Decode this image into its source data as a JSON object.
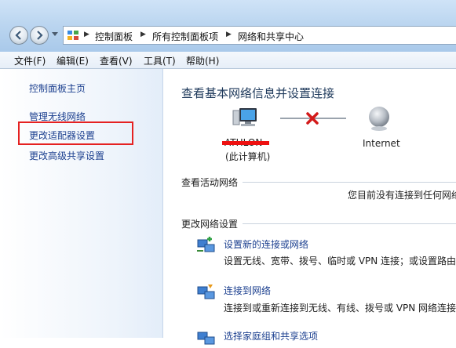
{
  "breadcrumb": {
    "items": [
      "控制面板",
      "所有控制面板项",
      "网络和共享中心"
    ]
  },
  "menu": {
    "items": [
      "文件(F)",
      "编辑(E)",
      "查看(V)",
      "工具(T)",
      "帮助(H)"
    ]
  },
  "sidebar": {
    "items": [
      {
        "label": "控制面板主页"
      },
      {
        "label": "管理无线网络"
      },
      {
        "label": "更改适配器设置",
        "highlighted": true
      },
      {
        "label": "更改高级共享设置"
      }
    ]
  },
  "main": {
    "title": "查看基本网络信息并设置连接",
    "network_map": {
      "computer_name": "ATHLON",
      "computer_sub": "(此计算机)",
      "internet_label": "Internet",
      "connection_status": "disconnected"
    },
    "active_networks": {
      "label": "查看活动网络",
      "status": "您目前没有连接到任何网络"
    },
    "change_settings": {
      "label": "更改网络设置",
      "tasks": [
        {
          "link": "设置新的连接或网络",
          "desc": "设置无线、宽带、拨号、临时或 VPN 连接；或设置路由"
        },
        {
          "link": "连接到网络",
          "desc": "连接到或重新连接到无线、有线、拨号或 VPN 网络连接"
        },
        {
          "link": "选择家庭组和共享选项",
          "desc": ""
        }
      ]
    }
  },
  "colors": {
    "link": "#1b3f8f",
    "title": "#1e395b",
    "highlight_box": "#e52121",
    "disconnect_x": "#d31a1a"
  }
}
